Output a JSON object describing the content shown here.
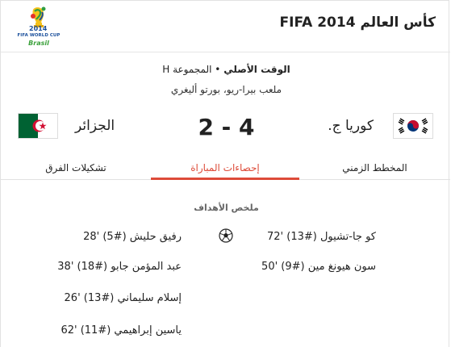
{
  "header": {
    "title": "كأس العالم FIFA 2014"
  },
  "logo": {
    "line1": "FIFA WORLD CUP",
    "line2": "Brasil"
  },
  "match": {
    "time_label": "الوقت الأصلي",
    "separator": "•",
    "group": "المجموعة H",
    "venue": "ملعب بيرا-ريو، بورتو أليغري",
    "score": "2 - 4"
  },
  "teams": {
    "left": {
      "name": "الجزائر",
      "flag": "algeria-flag"
    },
    "right": {
      "name": "كوريا ج.",
      "flag": "south-korea-flag"
    }
  },
  "tabs": [
    {
      "label": "تشكيلات الفرق"
    },
    {
      "label": "إحصاءات المباراة",
      "active": true
    },
    {
      "label": "المخطط الزمني"
    }
  ],
  "goals": {
    "title": "ملخص الأهداف",
    "left": [
      "رفيق حليش (#5) '28",
      "عبد المؤمن جابو (#18) '38",
      "إسلام سليماني (#13) '26",
      "ياسين إبراهيمي (#11) '62"
    ],
    "right": [
      "كو جا-تشيول (#13) '72",
      "سون هيونغ مين (#9) '50"
    ]
  },
  "colors": {
    "accent": "#dd4b39",
    "algeria_green": "#006233",
    "algeria_red": "#d21034"
  }
}
